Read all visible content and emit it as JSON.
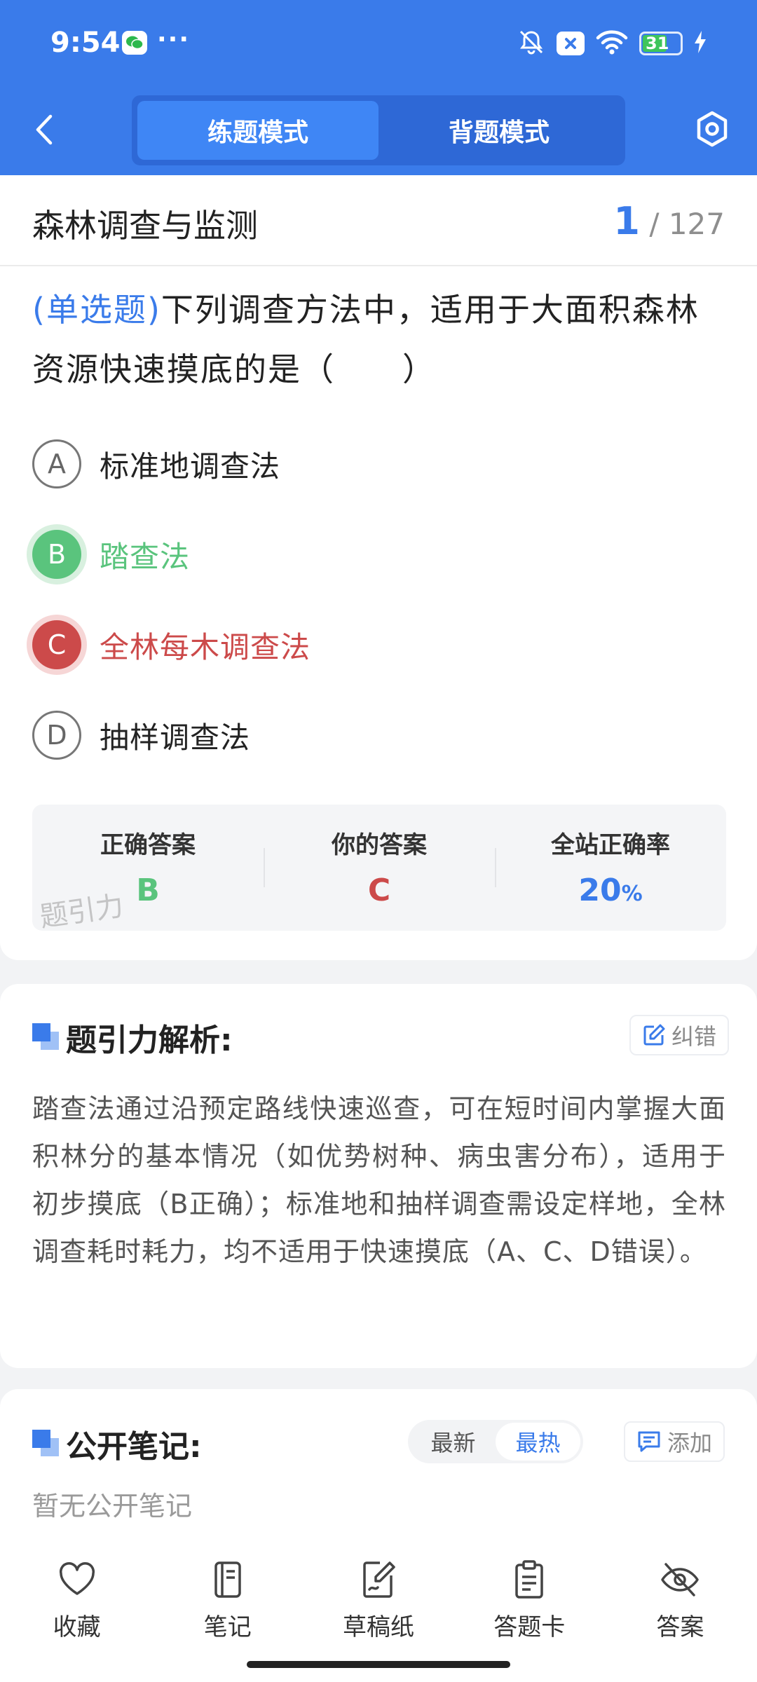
{
  "status": {
    "time": "9:54",
    "dots": "···",
    "battery": "31"
  },
  "nav": {
    "tabs": [
      {
        "label": "练题模式",
        "active": true
      },
      {
        "label": "背题模式",
        "active": false
      }
    ]
  },
  "header": {
    "title": "森林调查与监测",
    "current": "1",
    "total": "/ 127"
  },
  "question": {
    "type": "(单选题)",
    "text": "下列调查方法中，适用于大面积森林资源快速摸底的是（　　）"
  },
  "options": [
    {
      "letter": "A",
      "text": "标准地调查法",
      "state": "normal"
    },
    {
      "letter": "B",
      "text": "踏查法",
      "state": "correct"
    },
    {
      "letter": "C",
      "text": "全林每木调查法",
      "state": "wrong"
    },
    {
      "letter": "D",
      "text": "抽样调查法",
      "state": "normal"
    }
  ],
  "answers": {
    "correct_label": "正确答案",
    "correct_value": "B",
    "yours_label": "你的答案",
    "yours_value": "C",
    "rate_label": "全站正确率",
    "rate_value": "20",
    "rate_unit": "%",
    "watermark": "题引力"
  },
  "analysis": {
    "title": "题引力解析:",
    "report_label": "纠错",
    "text": "踏查法通过沿预定路线快速巡查，可在短时间内掌握大面积林分的基本情况（如优势树种、病虫害分布），适用于初步摸底（B正确）；标准地和抽样调查需设定样地，全林调查耗时耗力，均不适用于快速摸底（A、C、D错误）。"
  },
  "notes": {
    "title": "公开笔记:",
    "sort": [
      {
        "label": "最新",
        "active": false
      },
      {
        "label": "最热",
        "active": true
      }
    ],
    "add_label": "添加",
    "empty": "暂无公开笔记"
  },
  "toolbar": [
    {
      "label": "收藏",
      "icon": "heart-icon"
    },
    {
      "label": "笔记",
      "icon": "notebook-icon"
    },
    {
      "label": "草稿纸",
      "icon": "draft-icon"
    },
    {
      "label": "答题卡",
      "icon": "answer-sheet-icon"
    },
    {
      "label": "答案",
      "icon": "eye-off-icon"
    }
  ],
  "colors": {
    "primary": "#3a7bea",
    "correct": "#5ac47d",
    "wrong": "#cc4a4a"
  }
}
